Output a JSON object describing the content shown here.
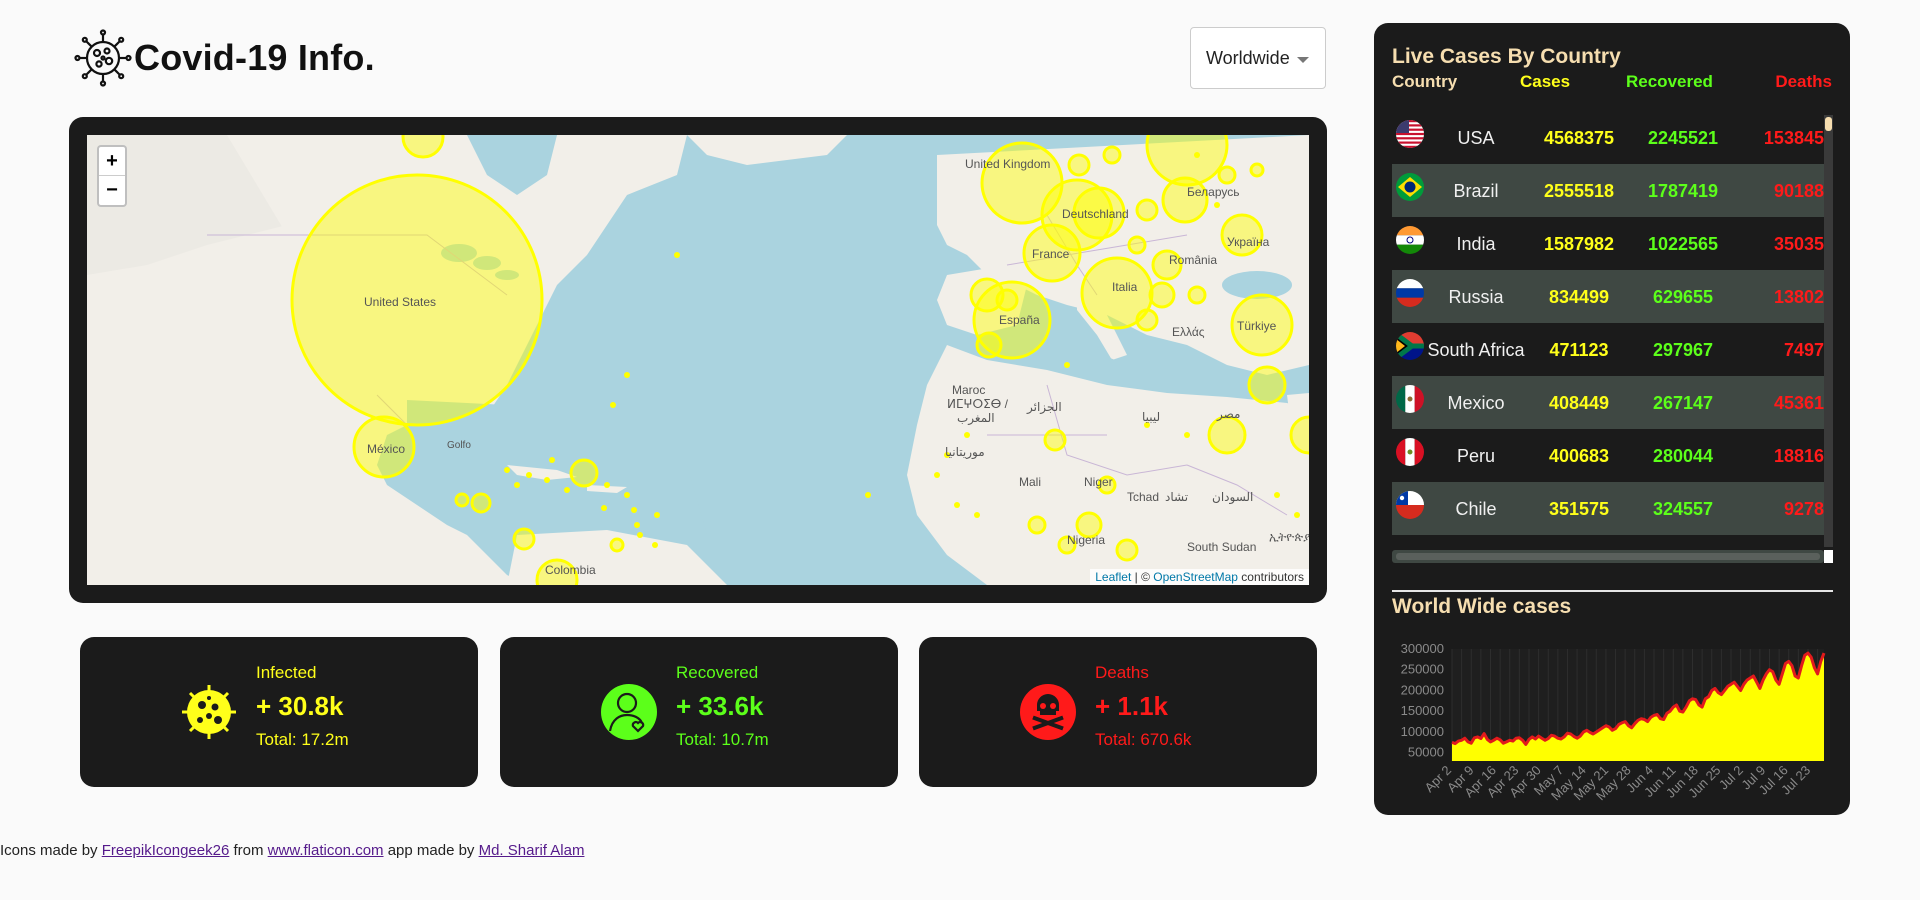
{
  "header": {
    "title": "Covid-19 Info."
  },
  "region_select": {
    "value": "Worldwide"
  },
  "map": {
    "zoom_in": "+",
    "zoom_out": "−",
    "attribution_leaflet": "Leaflet",
    "attribution_sep": " | © ",
    "attribution_osm": "OpenStreetMap",
    "attribution_contrib": " contributors",
    "labels": {
      "united_states": "United States",
      "mexico": "México",
      "united_kingdom": "United Kingdom",
      "deutschland": "Deutschland",
      "france": "France",
      "espana": "España",
      "italia": "Italia",
      "romania": "România",
      "ukraina": "Україна",
      "belarus": "Беларусь",
      "turkiye": "Türkiye",
      "ellas": "Ελλάς",
      "maroc": "Maroc",
      "mali": "Mali",
      "niger": "Niger",
      "tchad": "Tchad",
      "nigeria": "Nigeria",
      "south_sudan": "South Sudan",
      "colombia": "Colombia",
      "algeria": "الجزائر",
      "libya": "ليبيا",
      "egypt": "مصر",
      "sudan": "السودان",
      "mauritania": "موريتانيا",
      "tchad_ar": "تشاد",
      "golfo": "Golfo",
      "ethiopia": "ኢትዮጵያ",
      "maroc_ar": "المغرب",
      "maroc_tif": "ⵍⵎⵖⵔⵉⴱ /"
    }
  },
  "cards": {
    "infected": {
      "title": "Infected",
      "today": "+ 30.8k",
      "total": "Total: 17.2m",
      "icon": "virus-icon"
    },
    "recovered": {
      "title": "Recovered",
      "today": "+ 33.6k",
      "total": "Total: 10.7m",
      "icon": "recovered-person-icon"
    },
    "deaths": {
      "title": "Deaths",
      "today": "+ 1.1k",
      "total": "Total: 670.6k",
      "icon": "skull-crossbones-icon"
    }
  },
  "panel": {
    "title": "Live Cases By Country",
    "columns": {
      "country": "Country",
      "cases": "Cases",
      "recovered": "Recovered",
      "deaths": "Deaths"
    },
    "rows": [
      {
        "country": "USA",
        "cases": "4568375",
        "recovered": "2245521",
        "deaths": "153845",
        "flag": "us-flag"
      },
      {
        "country": "Brazil",
        "cases": "2555518",
        "recovered": "1787419",
        "deaths": "90188",
        "flag": "brazil-flag"
      },
      {
        "country": "India",
        "cases": "1587982",
        "recovered": "1022565",
        "deaths": "35035",
        "flag": "india-flag"
      },
      {
        "country": "Russia",
        "cases": "834499",
        "recovered": "629655",
        "deaths": "13802",
        "flag": "russia-flag"
      },
      {
        "country": "South Africa",
        "cases": "471123",
        "recovered": "297967",
        "deaths": "7497",
        "flag": "south-africa-flag"
      },
      {
        "country": "Mexico",
        "cases": "408449",
        "recovered": "267147",
        "deaths": "45361",
        "flag": "mexico-flag"
      },
      {
        "country": "Peru",
        "cases": "400683",
        "recovered": "280044",
        "deaths": "18816",
        "flag": "peru-flag"
      },
      {
        "country": "Chile",
        "cases": "351575",
        "recovered": "324557",
        "deaths": "9278",
        "flag": "chile-flag"
      }
    ],
    "chart_title": "World Wide cases"
  },
  "chart_data": {
    "type": "area",
    "title": "World Wide cases",
    "xlabel": "",
    "ylabel": "",
    "ylim": [
      30000,
      300000
    ],
    "yticks": [
      50000,
      100000,
      150000,
      200000,
      250000,
      300000
    ],
    "xtick_labels": [
      "Apr 2",
      "Apr 9",
      "Apr 16",
      "Apr 23",
      "Apr 30",
      "May 7",
      "May 14",
      "May 21",
      "May 28",
      "Jun 4",
      "Jun 11",
      "Jun 18",
      "Jun 25",
      "Jul 2",
      "Jul 9",
      "Jul 16",
      "Jul 23"
    ],
    "x_start": "Apr 2",
    "values": [
      75000,
      72000,
      78000,
      80000,
      85000,
      76000,
      73000,
      86000,
      88000,
      84000,
      96000,
      82000,
      76000,
      80000,
      85000,
      81000,
      73000,
      76000,
      80000,
      78000,
      85000,
      86000,
      80000,
      70000,
      82000,
      88000,
      83000,
      90000,
      85000,
      80000,
      84000,
      92000,
      90000,
      85000,
      83000,
      88000,
      97000,
      95000,
      89000,
      85000,
      90000,
      100000,
      104000,
      99000,
      95000,
      100000,
      105000,
      110000,
      115000,
      112000,
      104000,
      108000,
      118000,
      122000,
      125000,
      115000,
      110000,
      120000,
      128000,
      132000,
      130000,
      125000,
      135000,
      140000,
      142000,
      132000,
      130000,
      145000,
      150000,
      160000,
      165000,
      150000,
      148000,
      160000,
      175000,
      180000,
      178000,
      165000,
      160000,
      180000,
      185000,
      200000,
      205000,
      195000,
      190000,
      200000,
      210000,
      215000,
      220000,
      210000,
      200000,
      215000,
      225000,
      230000,
      235000,
      220000,
      205000,
      225000,
      240000,
      250000,
      245000,
      225000,
      215000,
      240000,
      265000,
      270000,
      260000,
      235000,
      230000,
      260000,
      285000,
      290000,
      280000,
      255000,
      240000,
      270000,
      290000
    ],
    "fill_color": "#ffff00",
    "line_color": "#e31a1c"
  },
  "footer": {
    "prefix": "Icons made by ",
    "link1": "FreepikIcongeek26",
    "mid1": " from ",
    "link2": "www.flaticon.com",
    "mid2": " app made by ",
    "link3": "Md. Sharif Alam"
  }
}
